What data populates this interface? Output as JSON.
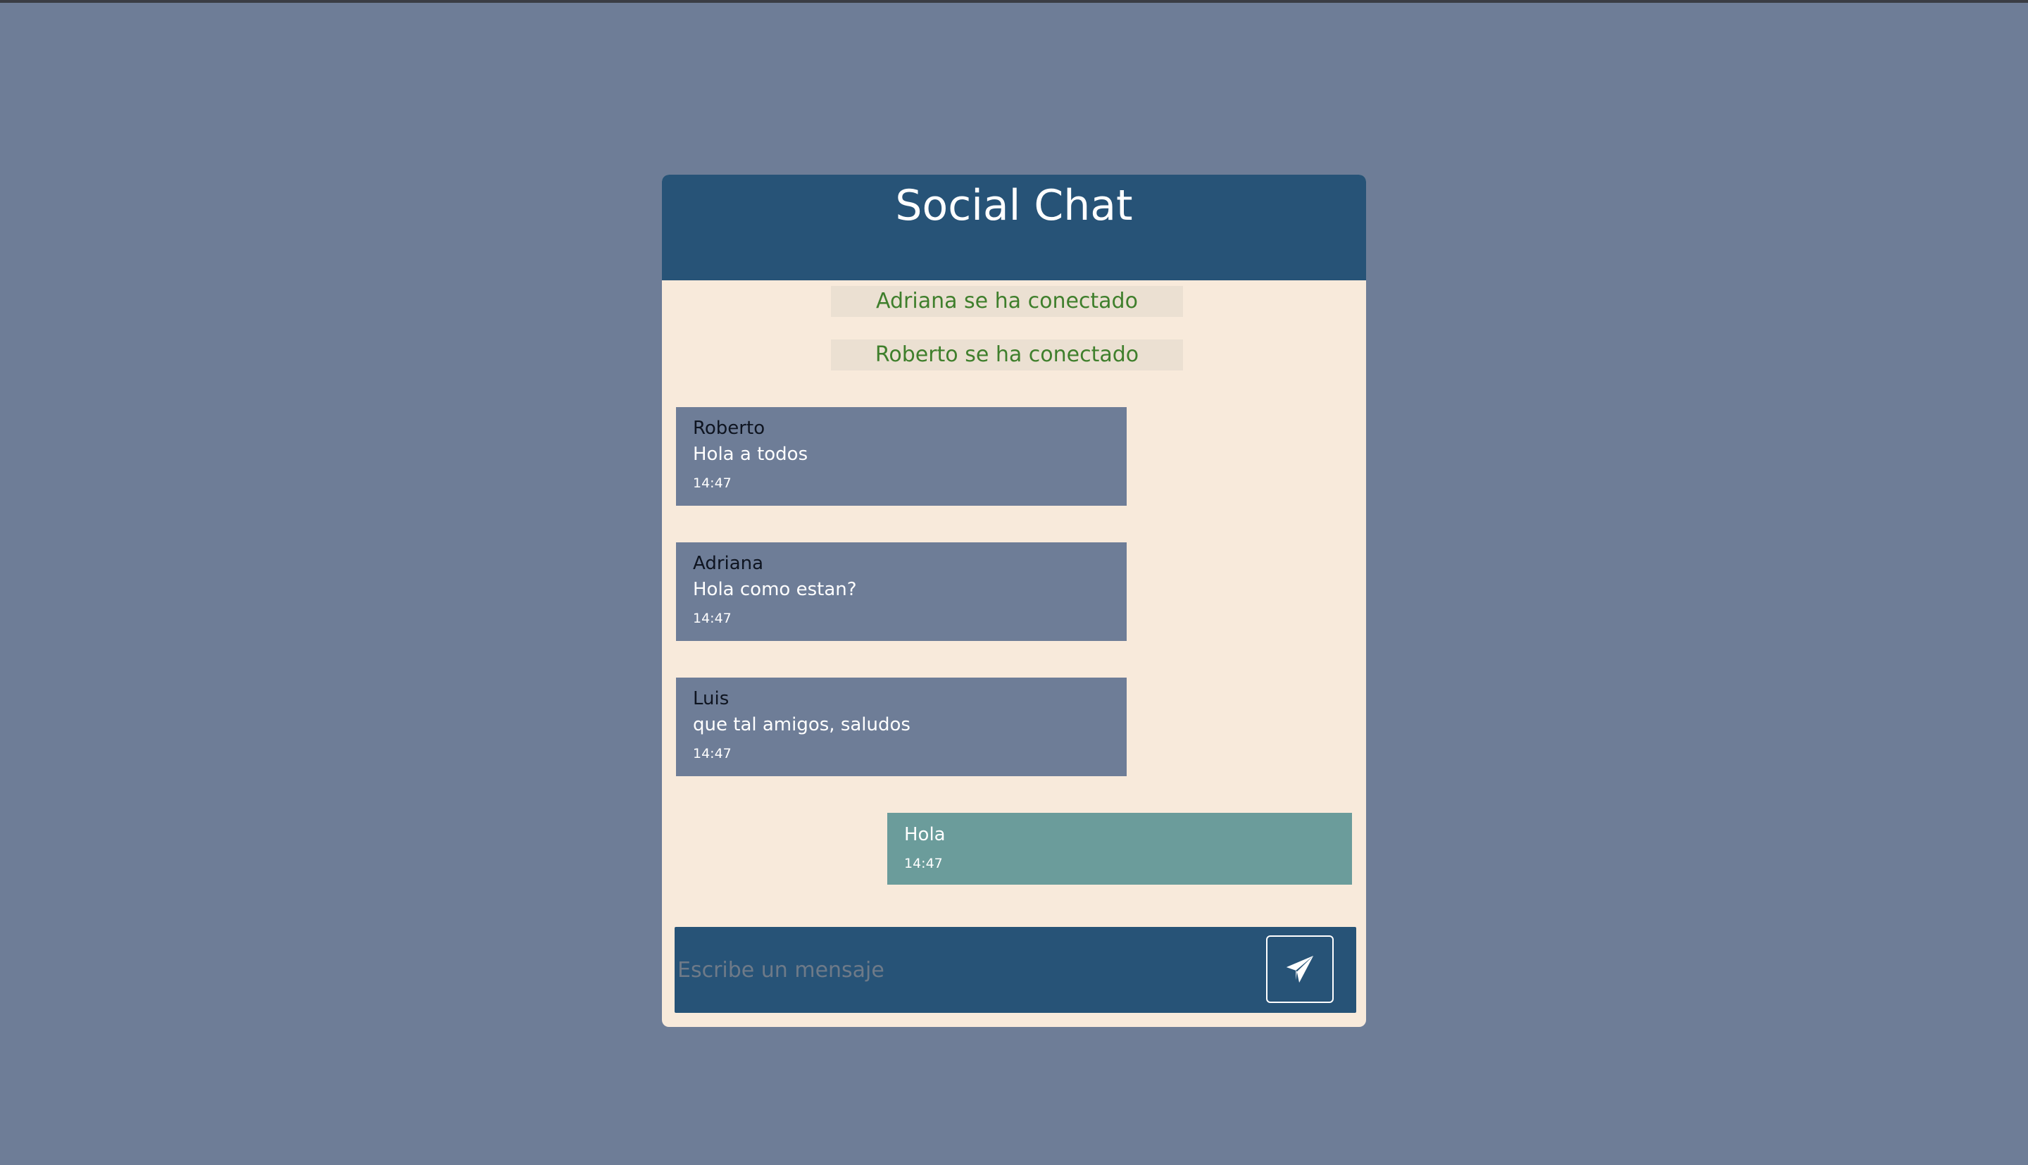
{
  "app": {
    "title": "Social Chat"
  },
  "system_messages": [
    "Adriana se ha conectado",
    "Roberto se ha conectado"
  ],
  "messages": [
    {
      "author": "Roberto",
      "text": "Hola a todos",
      "time": "14:47",
      "own": false
    },
    {
      "author": "Adriana",
      "text": "Hola como estan?",
      "time": "14:47",
      "own": false
    },
    {
      "author": "Luis",
      "text": "que tal amigos, saludos",
      "time": "14:47",
      "own": false
    },
    {
      "text": "Hola",
      "time": "14:47",
      "own": true
    }
  ],
  "composer": {
    "placeholder": "Escribe un mensaje",
    "value": "",
    "send_icon": "paper-plane-icon"
  },
  "colors": {
    "page_background": "#6e7d97",
    "header": "#275377",
    "chat_background": "#f8eadb",
    "system_text": "#3f7f2c",
    "others_bubble": "#6e7d97",
    "own_bubble": "#6b9c9b"
  }
}
